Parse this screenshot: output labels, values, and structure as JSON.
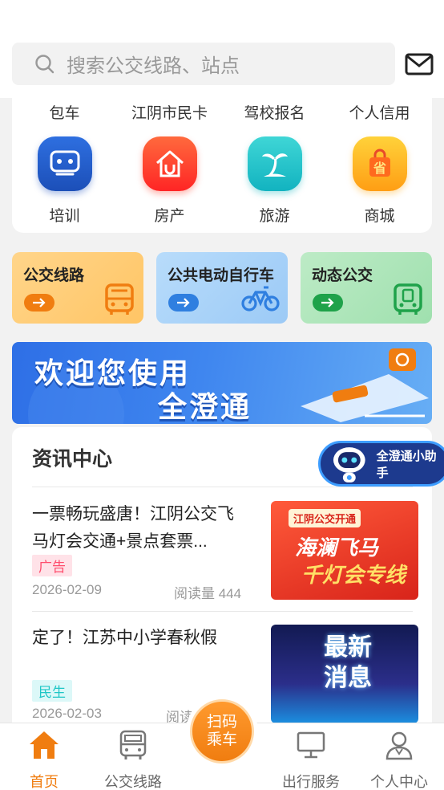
{
  "search": {
    "placeholder": "搜索公交线路、站点"
  },
  "services_top": [
    "包车",
    "江阴市民卡",
    "驾校报名",
    "个人信用"
  ],
  "services": [
    {
      "label": "培训",
      "icon": "training-icon",
      "color": "#1d56c4"
    },
    {
      "label": "房产",
      "icon": "house-icon",
      "color": "#ff3b2f"
    },
    {
      "label": "旅游",
      "icon": "palm-tree-icon",
      "color": "#18c3c9"
    },
    {
      "label": "商城",
      "icon": "shopping-bag-icon",
      "color": "#ffb320"
    }
  ],
  "quick_links": [
    {
      "label": "公交线路",
      "icon": "bus-icon"
    },
    {
      "label": "公共电动自行车",
      "icon": "bicycle-icon"
    },
    {
      "label": "动态公交",
      "icon": "realtime-bus-icon"
    }
  ],
  "banner": {
    "line1": "欢迎您使用",
    "line2": "全澄通"
  },
  "news": {
    "title": "资讯中心",
    "articles": [
      {
        "headline": "一票畅玩盛唐！江阴公交飞马灯会交通+景点套票...",
        "tag": "广告",
        "date": "2026-02-09",
        "reads": "阅读量 444",
        "thumb": {
          "caption1": "江阴公交开通",
          "caption2": "海澜飞马",
          "caption3": "千灯会专线"
        }
      },
      {
        "headline": "定了！江苏中小学春秋假",
        "tag": "民生",
        "date": "2026-02-03",
        "reads": "阅读",
        "thumb": {
          "caption1": "最新",
          "caption2": "消息"
        }
      }
    ]
  },
  "assistant": {
    "label": "全澄通小助手"
  },
  "scan": {
    "line1": "扫码",
    "line2": "乘车"
  },
  "tabs": [
    {
      "label": "首页",
      "icon": "home-icon",
      "active": true
    },
    {
      "label": "公交线路",
      "icon": "bus-icon",
      "active": false
    },
    {
      "label": "出行服务",
      "icon": "monitor-icon",
      "active": false
    },
    {
      "label": "个人中心",
      "icon": "user-icon",
      "active": false
    }
  ],
  "colors": {
    "accent": "#f07d10",
    "ad_tag": "#ff4d6d",
    "life_tag": "#1ec6c6"
  }
}
